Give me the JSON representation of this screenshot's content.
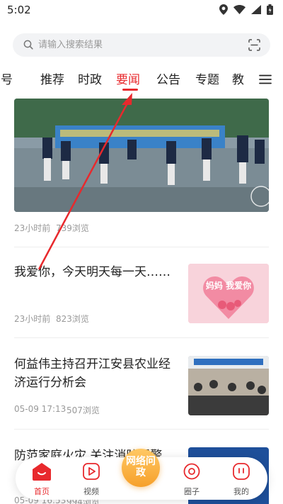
{
  "status_bar": {
    "time": "5:02"
  },
  "search": {
    "placeholder": "请输入搜索结果"
  },
  "tabs": [
    {
      "label": "台号"
    },
    {
      "label": "推荐"
    },
    {
      "label": "时政"
    },
    {
      "label": "要闻"
    },
    {
      "label": "公告"
    },
    {
      "label": "专题"
    },
    {
      "label": "教"
    }
  ],
  "active_tab": "要闻",
  "feed": {
    "hero": {
      "time": "23小时前",
      "views": "739浏览"
    },
    "articles": [
      {
        "title": "我爱你，今天明天每一天……",
        "time": "23小时前",
        "views": "823浏览",
        "thumb_text": "妈妈 我爱你"
      },
      {
        "title": "何益伟主持召开江安县农业经济运行分析会",
        "time": "05-09 17:13",
        "views": "507浏览"
      },
      {
        "title": "防范家庭火灾 关注消防报警",
        "time": "05-09 16:53",
        "views": "994浏览"
      }
    ]
  },
  "bottom_nav": {
    "items": [
      {
        "label": "首页"
      },
      {
        "label": "视频"
      },
      {
        "label": "网络问政"
      },
      {
        "label": "圈子"
      },
      {
        "label": "我的"
      }
    ]
  },
  "colors": {
    "accent": "#e8292d",
    "center_button": "#f6a02a"
  }
}
